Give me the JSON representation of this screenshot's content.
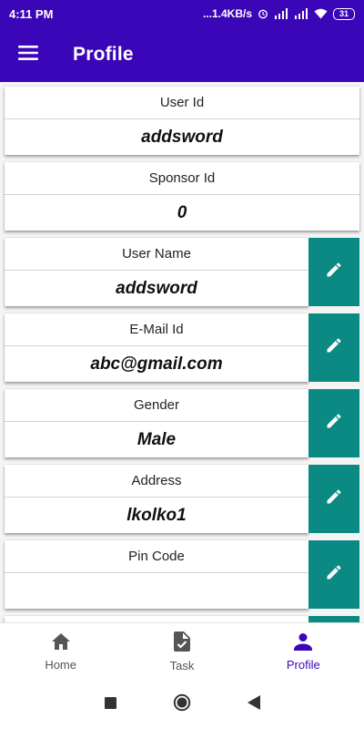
{
  "status_bar": {
    "time": "4:11 PM",
    "net_speed": "...1.4KB/s",
    "battery": "31"
  },
  "app_bar": {
    "title": "Profile",
    "menu_icon": "hamburger-menu-icon"
  },
  "fields": [
    {
      "label": "User Id",
      "value": "addsword",
      "editable": false
    },
    {
      "label": "Sponsor Id",
      "value": "0",
      "editable": false
    },
    {
      "label": "User Name",
      "value": "addsword",
      "editable": true
    },
    {
      "label": "E-Mail Id",
      "value": "abc@gmail.com",
      "editable": true
    },
    {
      "label": "Gender",
      "value": "Male",
      "editable": true
    },
    {
      "label": "Address",
      "value": "lkolko1",
      "editable": true
    },
    {
      "label": "Pin Code",
      "value": "",
      "editable": true
    }
  ],
  "bottom_nav": {
    "items": [
      {
        "label": "Home",
        "icon": "home-icon",
        "active": false
      },
      {
        "label": "Task",
        "icon": "task-icon",
        "active": false
      },
      {
        "label": "Profile",
        "icon": "person-icon",
        "active": true
      }
    ]
  },
  "colors": {
    "primary": "#3a06b8",
    "edit_button": "#0a8a83",
    "background": "#f4f4f4"
  }
}
